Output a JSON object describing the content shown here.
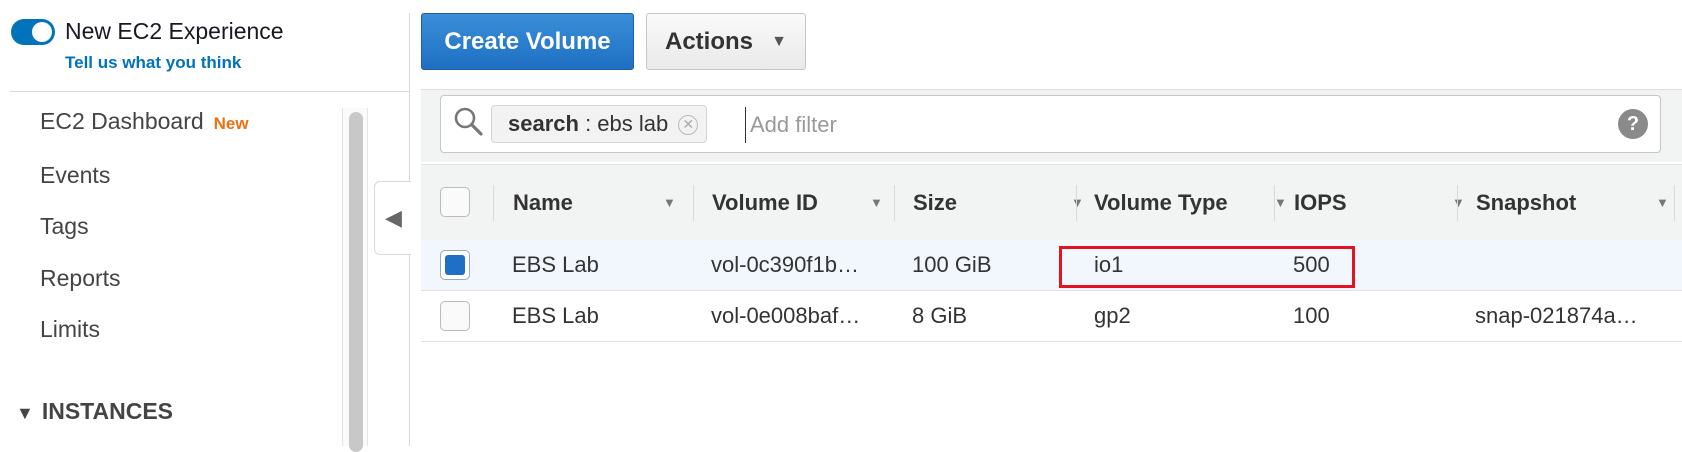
{
  "experience": {
    "title": "New EC2 Experience",
    "feedback_link": "Tell us what you think",
    "enabled": true
  },
  "sidebar": {
    "items": [
      {
        "label": "EC2 Dashboard",
        "badge": "New"
      },
      {
        "label": "Events"
      },
      {
        "label": "Tags"
      },
      {
        "label": "Reports"
      },
      {
        "label": "Limits"
      }
    ],
    "section": {
      "label": "INSTANCES",
      "expanded": true
    }
  },
  "toolbar": {
    "create_label": "Create Volume",
    "actions_label": "Actions"
  },
  "filter": {
    "token_key": "search",
    "token_sep": " : ",
    "token_value": "ebs lab",
    "placeholder": "Add filter",
    "help": "?"
  },
  "table": {
    "columns": [
      "Name",
      "Volume ID",
      "Size",
      "Volume Type",
      "IOPS",
      "Snapshot"
    ],
    "rows": [
      {
        "name": "EBS Lab",
        "volume_id": "vol-0c390f1b…",
        "size": "100 GiB",
        "type": "io1",
        "iops": "500",
        "snapshot": "",
        "selected": true
      },
      {
        "name": "EBS Lab",
        "volume_id": "vol-0e008baf…",
        "size": "8 GiB",
        "type": "gp2",
        "iops": "100",
        "snapshot": "snap-021874a…",
        "selected": false
      }
    ]
  },
  "colors": {
    "primary": "#1e6fc3",
    "link": "#0073bb",
    "badge_new": "#ec7211",
    "highlight": "#e2141f",
    "selected_row": "#f1f7fd"
  }
}
